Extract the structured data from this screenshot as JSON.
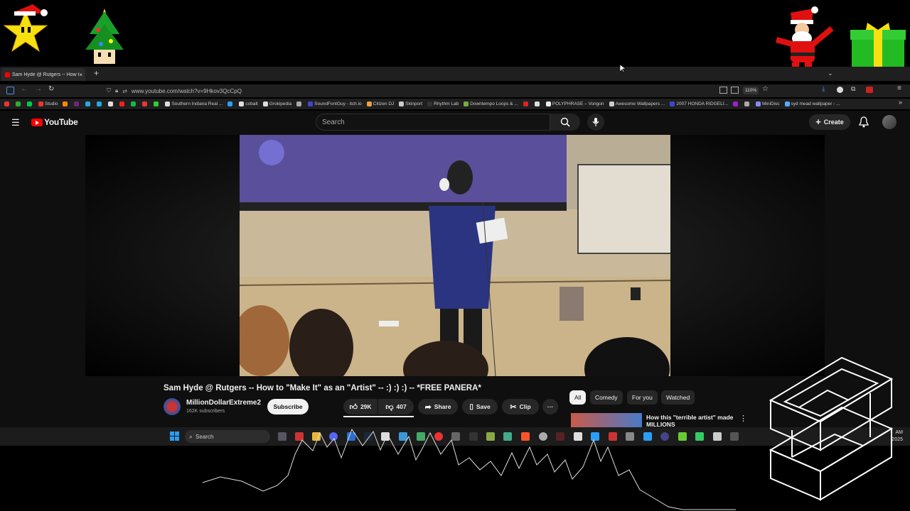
{
  "browser": {
    "tab_title": "Sam Hyde @ Rutgers -- How to \"Make It\" as an \"Artist\"",
    "tab_close": "×",
    "new_tab": "+",
    "url": "www.youtube.com/watch?v=9Hkov3QcCpQ",
    "zoom": "110%",
    "bookmarks": [
      {
        "label": "Studio",
        "color": "#e33"
      },
      {
        "label": "Southern Indiana Real ...",
        "color": "#ddd"
      },
      {
        "label": "cobalt",
        "color": "#2a9df4"
      },
      {
        "label": "Grokipedia",
        "color": "#ddd"
      },
      {
        "label": "SoundFontGuy - itch.io",
        "color": "#fa5c5c"
      },
      {
        "label": "Citizen DJ",
        "color": "#e8a33c"
      },
      {
        "label": "Skinport",
        "color": "#ccc"
      },
      {
        "label": "Rhythm Lab",
        "color": "#333"
      },
      {
        "label": "Downtempo Loops & ...",
        "color": "#7a4"
      },
      {
        "label": "POLYPHRASE – Vongon",
        "color": "#eee"
      },
      {
        "label": "Awesome Wallpapers ...",
        "color": "#ccc"
      },
      {
        "label": "2007 HONDA RIDGELI...",
        "color": "#44c"
      },
      {
        "label": "MiniDisc",
        "color": "#88f"
      },
      {
        "label": "syd mead wallpaper - ...",
        "color": "#5af"
      }
    ]
  },
  "youtube": {
    "logo_text": "YouTube",
    "search_placeholder": "Search",
    "create_label": "Create",
    "video_title": "Sam Hyde @ Rutgers -- How to \"Make It\" as an \"Artist\" -- :) :) :) -- *FREE PANERA*",
    "channel_name": "MillionDollarExtreme2",
    "channel_subs": "162K subscribers",
    "subscribe_label": "Subscribe",
    "likes": "29K",
    "dislikes": "407",
    "share_label": "Share",
    "save_label": "Save",
    "clip_label": "Clip",
    "more_label": "···",
    "chips": [
      "All",
      "Comedy",
      "For you",
      "Watched"
    ],
    "recommendation_title": "How this \"terrible artist\" made MILLIONS"
  },
  "taskbar": {
    "search_placeholder": "Search",
    "time": "AM",
    "date": "2025"
  },
  "colors": {
    "youtube_red": "#ff0000",
    "bg": "#0f0f0f",
    "chrome": "#1f1f1f"
  }
}
